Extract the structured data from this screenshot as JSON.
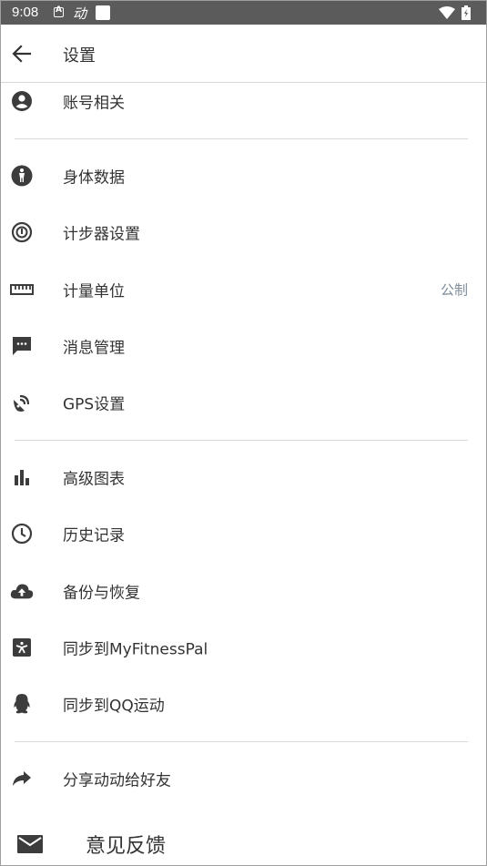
{
  "status_bar": {
    "time": "9:08",
    "notification_a": "A",
    "app_text": "动"
  },
  "toolbar": {
    "title": "设置",
    "back_icon": "arrow-left-icon"
  },
  "colors": {
    "status_bar_bg": "#5b5b5b",
    "icon_color": "#3c3c3c",
    "value_color": "#7d8d9b",
    "divider": "#d9d9d9"
  },
  "settings": {
    "account": {
      "label": "账号相关",
      "icon": "account-circle-icon"
    },
    "body_data": {
      "label": "身体数据",
      "icon": "body-icon"
    },
    "pedometer": {
      "label": "计步器设置",
      "icon": "pedometer-icon"
    },
    "units": {
      "label": "计量单位",
      "icon": "ruler-icon",
      "value": "公制"
    },
    "messages": {
      "label": "消息管理",
      "icon": "message-icon"
    },
    "gps": {
      "label": "GPS设置",
      "icon": "gps-signal-icon"
    },
    "charts": {
      "label": "高级图表",
      "icon": "bar-chart-icon"
    },
    "history": {
      "label": "历史记录",
      "icon": "clock-icon"
    },
    "backup": {
      "label": "备份与恢复",
      "icon": "cloud-upload-icon"
    },
    "myfitnesspal": {
      "label": "同步到MyFitnessPal",
      "icon": "myfitnesspal-icon"
    },
    "qq": {
      "label": "同步到QQ运动",
      "icon": "qq-penguin-icon"
    },
    "share": {
      "label": "分享动动给好友",
      "icon": "share-arrow-icon"
    },
    "feedback": {
      "label": "意见反馈",
      "icon": "mail-icon"
    }
  }
}
